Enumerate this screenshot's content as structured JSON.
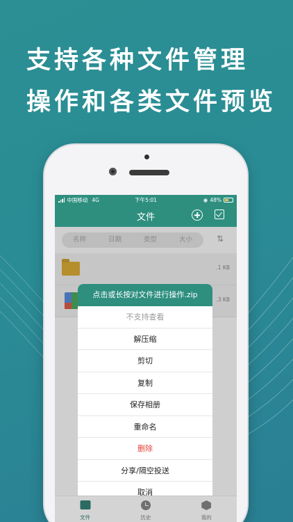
{
  "headline": {
    "line1": "支持各种文件管理",
    "line2": "操作和各类文件预览"
  },
  "status": {
    "carrier": "中国移动",
    "network": "4G",
    "time": "下午5:01",
    "battery": "48%"
  },
  "navbar": {
    "title": "文件",
    "add_icon": "plus-circle-icon",
    "select_icon": "checkbox-icon"
  },
  "sort_tabs": [
    "名称",
    "日期",
    "类型",
    "大小"
  ],
  "sort_icon": "sort-arrows-icon",
  "files": [
    {
      "icon": "folder-icon",
      "size": ".1 KB"
    },
    {
      "icon": "zip-icon",
      "size": ".3 KB"
    }
  ],
  "action_sheet": {
    "title": "点击或长按对文件进行操作.zip",
    "items": [
      {
        "label": "不支持查看",
        "style": "disabled"
      },
      {
        "label": "解压缩",
        "style": "normal"
      },
      {
        "label": "剪切",
        "style": "normal"
      },
      {
        "label": "复制",
        "style": "normal"
      },
      {
        "label": "保存相册",
        "style": "normal"
      },
      {
        "label": "重命名",
        "style": "normal"
      },
      {
        "label": "删除",
        "style": "danger"
      },
      {
        "label": "分享/隔空投送",
        "style": "normal"
      },
      {
        "label": "取消",
        "style": "normal"
      }
    ]
  },
  "tabbar": {
    "items": [
      {
        "label": "文件",
        "icon": "folder-icon",
        "active": true
      },
      {
        "label": "历史",
        "icon": "clock-icon",
        "active": false
      },
      {
        "label": "我的",
        "icon": "user-icon",
        "active": false
      }
    ]
  },
  "colors": {
    "background": "#2b8f93",
    "accent": "#2e8f7f",
    "danger": "#e0453a"
  }
}
